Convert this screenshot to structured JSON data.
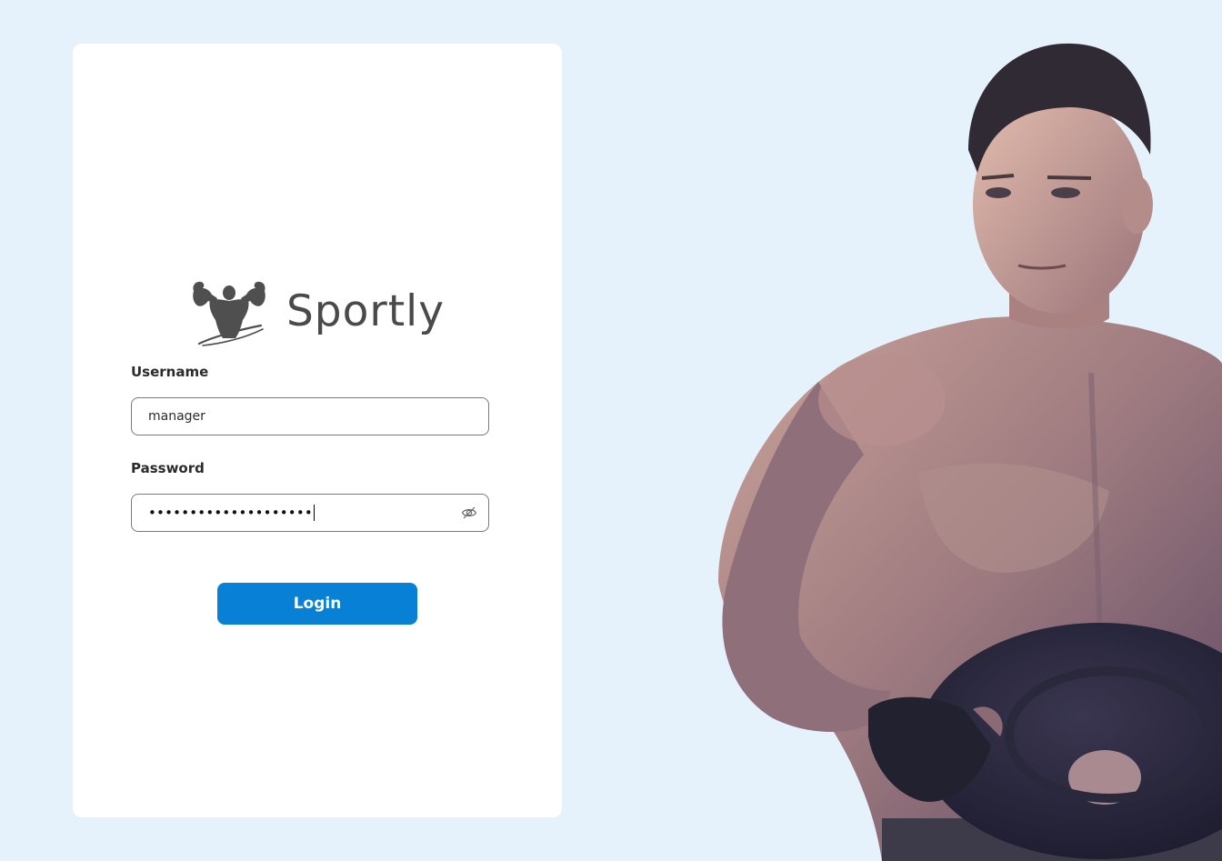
{
  "brand": {
    "name": "Sportly",
    "logo_icon": "flexing-bodybuilder-icon"
  },
  "form": {
    "username_label": "Username",
    "username_value": "manager",
    "password_label": "Password",
    "password_masked": "••••••••••••••••••••",
    "password_toggle_icon": "eye-off-icon",
    "login_label": "Login"
  },
  "hero_image": {
    "subject": "shirtless-athlete-holding-weight-plate-illustration"
  },
  "colors": {
    "page_background": "#e6f2fb",
    "card_background": "#ffffff",
    "primary_button": "#0780d6",
    "brand_text": "#4a4a4a"
  }
}
